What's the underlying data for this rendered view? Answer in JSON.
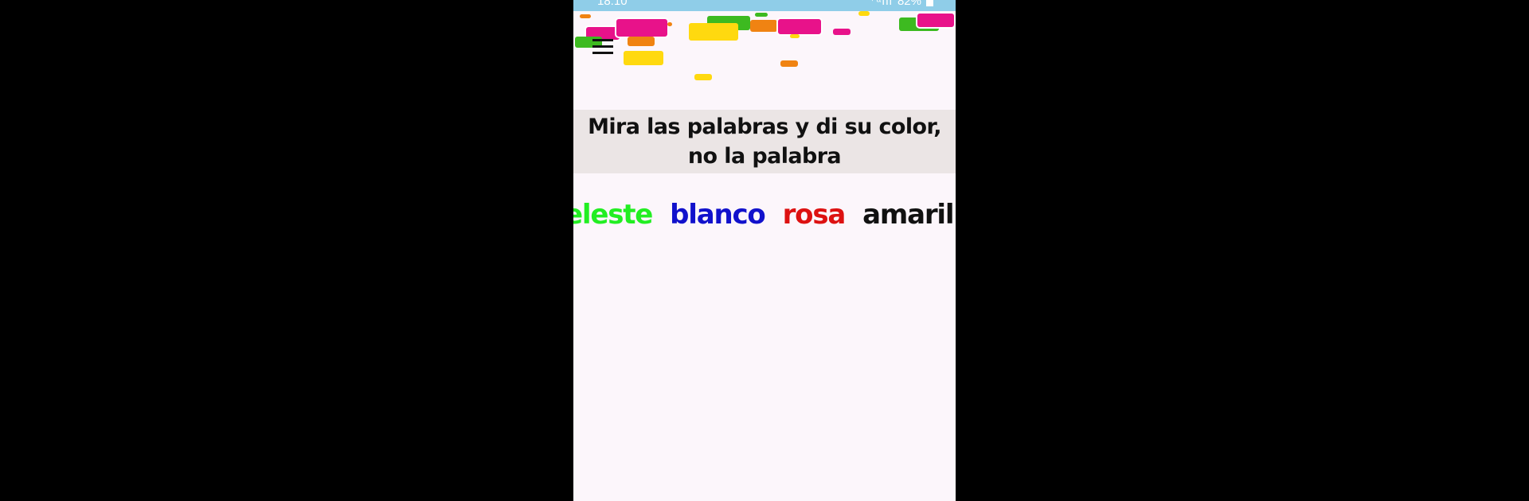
{
  "status_bar": {
    "time": "18:10",
    "signal": "⁺ᵃıll",
    "battery": "82%"
  },
  "menu": {
    "icon": "hamburger-menu-icon"
  },
  "instruction": {
    "text": "Mira las palabras y di su color, no la palabra"
  },
  "words": [
    {
      "text": "celeste",
      "color": "#22ee22"
    },
    {
      "text": "blanco",
      "color": "#1111cc"
    },
    {
      "text": "rosa",
      "color": "#dd1111"
    },
    {
      "text": "amarillo",
      "color": "#111111"
    }
  ],
  "confetti_colors": {
    "pink": "#e8128a",
    "green": "#3dba20",
    "orange": "#f08312",
    "yellow": "#ffd90f"
  }
}
